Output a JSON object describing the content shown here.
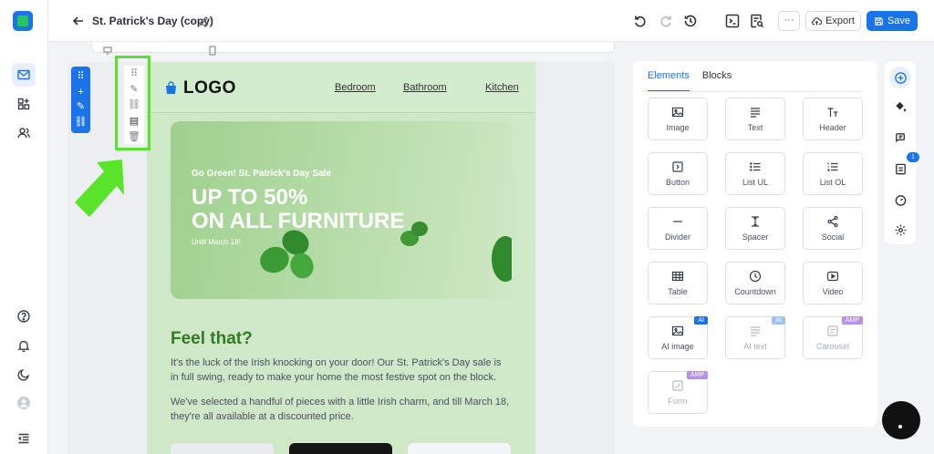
{
  "app": {
    "doc_title": "St. Patrick's Day (copy)",
    "export_label": "Export",
    "save_label": "Save",
    "more_label": "···"
  },
  "email": {
    "logo_text": "LOGO",
    "nav": [
      "Bedroom",
      "Bathroom",
      "Kitchen"
    ],
    "hero": {
      "kicker": "Go Green! St. Patrick's Day Sale",
      "headline_1": "UP TO 50%",
      "headline_2": "ON ALL FURNITURE",
      "until": "Until March 18!"
    },
    "heading": "Feel that?",
    "para_1": "It's the luck of the Irish knocking on your door! Our St. Patrick's Day sale is in full swing, ready to make your home the most festive spot on the block.",
    "para_2": "We've selected a handful of pieces with a little Irish charm, and till March 18, they're all available at a discounted price."
  },
  "panel": {
    "tabs": [
      "Elements",
      "Blocks"
    ],
    "active_tab": "Elements",
    "elements": [
      {
        "label": "Image",
        "icon": "image-icon"
      },
      {
        "label": "Text",
        "icon": "text-icon"
      },
      {
        "label": "Header",
        "icon": "header-icon"
      },
      {
        "label": "Button",
        "icon": "button-icon"
      },
      {
        "label": "List UL",
        "icon": "list-ul-icon"
      },
      {
        "label": "List OL",
        "icon": "list-ol-icon"
      },
      {
        "label": "Divider",
        "icon": "divider-icon"
      },
      {
        "label": "Spacer",
        "icon": "spacer-icon"
      },
      {
        "label": "Social",
        "icon": "social-icon"
      },
      {
        "label": "Table",
        "icon": "table-icon"
      },
      {
        "label": "Countdown",
        "icon": "countdown-icon"
      },
      {
        "label": "Video",
        "icon": "video-icon"
      },
      {
        "label": "AI image",
        "icon": "ai-image-icon",
        "badge": "AI"
      },
      {
        "label": "AI text",
        "icon": "ai-text-icon",
        "badge": "AI",
        "disabled": true
      },
      {
        "label": "Carousel",
        "icon": "carousel-icon",
        "badge": "AMP",
        "disabled": true
      },
      {
        "label": "Form",
        "icon": "form-icon",
        "badge": "AMP",
        "disabled": true
      }
    ]
  },
  "right_rail": {
    "notification_count": "1"
  },
  "colors": {
    "accent": "#1a73e8",
    "highlight": "#59e42a",
    "email_bg": "#cfe8c8",
    "heading_green": "#2f7d23"
  }
}
